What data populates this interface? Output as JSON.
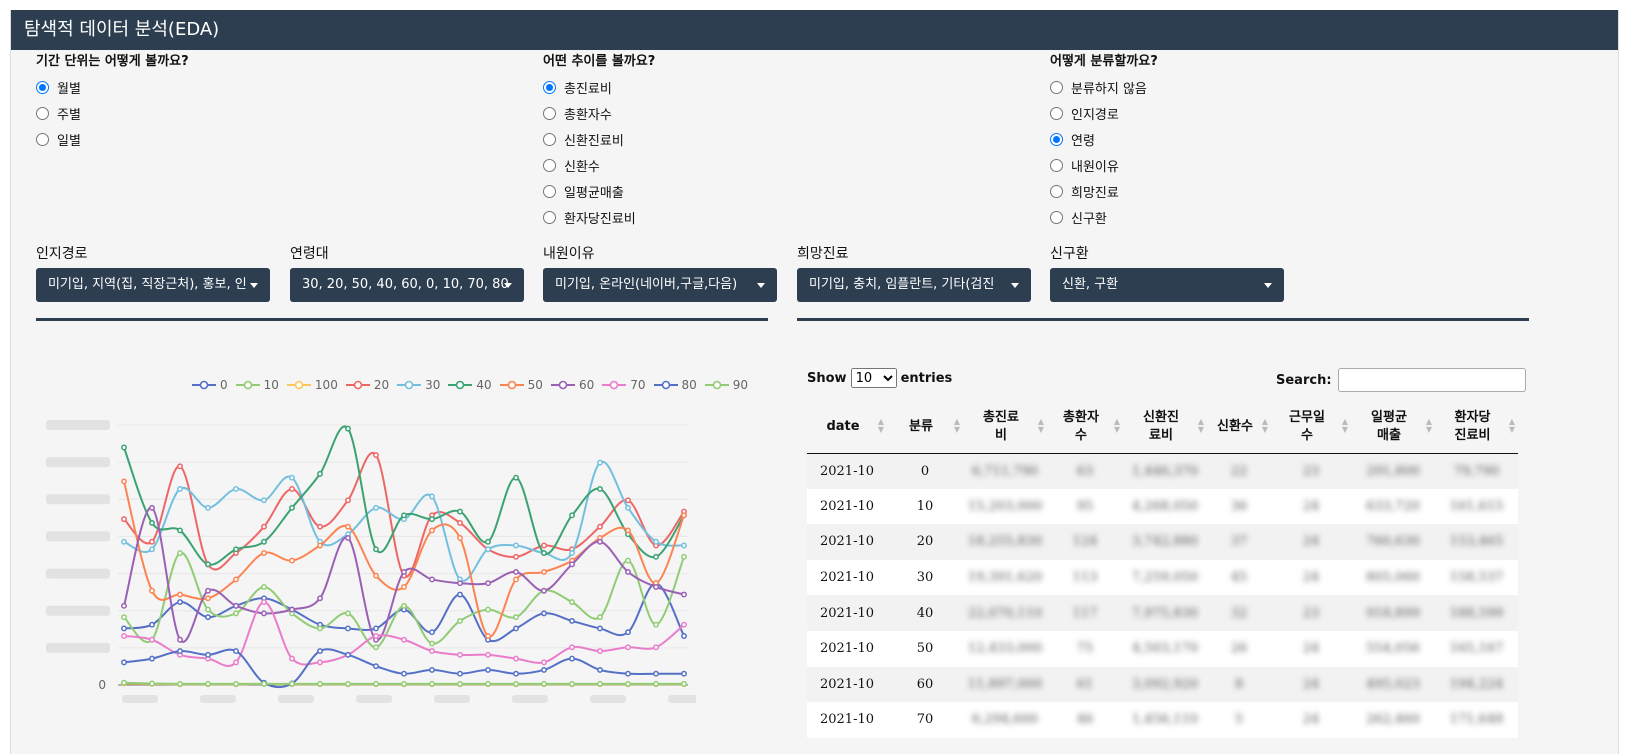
{
  "title": "탐색적 데이터 분석(EDA)",
  "period": {
    "question": "기간 단위는 어떻게 볼까요?",
    "options": [
      "월별",
      "주별",
      "일별"
    ],
    "selected": 0
  },
  "trend": {
    "question": "어떤 추이를 볼까요?",
    "options": [
      "총진료비",
      "총환자수",
      "신환진료비",
      "신환수",
      "일평균매출",
      "환자당진료비"
    ],
    "selected": 0
  },
  "group": {
    "question": "어떻게 분류할까요?",
    "options": [
      "분류하지 않음",
      "인지경로",
      "연령",
      "내원이유",
      "희망진료",
      "신구환"
    ],
    "selected": 2
  },
  "filters": [
    {
      "label": "인지경로",
      "value": "미기입, 지역(집, 직장근처), 홍보, 인"
    },
    {
      "label": "연령대",
      "value": "30, 20, 50, 40, 60, 0, 10, 70, 80"
    },
    {
      "label": "내원이유",
      "value": "미기입, 온라인(네이버,구글,다음)"
    },
    {
      "label": "희망진료",
      "value": "미기입, 충치, 임플란트, 기타(검진"
    },
    {
      "label": "신구환",
      "value": "신환, 구환"
    }
  ],
  "chart_data": {
    "type": "line",
    "y_axis": {
      "min_label": "0"
    },
    "series": [
      {
        "name": "0",
        "color": "#5470c6"
      },
      {
        "name": "10",
        "color": "#91cc75"
      },
      {
        "name": "100",
        "color": "#fac858"
      },
      {
        "name": "20",
        "color": "#ee6666"
      },
      {
        "name": "30",
        "color": "#73c0de"
      },
      {
        "name": "40",
        "color": "#3ba272"
      },
      {
        "name": "50",
        "color": "#fc8452"
      },
      {
        "name": "60",
        "color": "#9a60b4"
      },
      {
        "name": "70",
        "color": "#ea7ccc"
      },
      {
        "name": "80",
        "color": "#5470c6"
      },
      {
        "name": "90",
        "color": "#91cc75"
      }
    ]
  },
  "table": {
    "show_label": "Show",
    "entries_label": "entries",
    "page_size": "10",
    "search_label": "Search:",
    "columns": [
      "date",
      "분류",
      "총진료\n비",
      "총환자\n수",
      "신환진\n료비",
      "신환수",
      "근무일\n수",
      "일평균\n매출",
      "환자당\n진료비"
    ],
    "rows": [
      [
        "2021-10",
        "0",
        "6,711,790",
        "63",
        "1,446,370",
        "22",
        "23",
        "291,800",
        "79,790"
      ],
      [
        "2021-10",
        "10",
        "15,203,000",
        "95",
        "4,268,050",
        "36",
        "24",
        "633,720",
        "161,615"
      ],
      [
        "2021-10",
        "20",
        "18,255,830",
        "124",
        "3,742,880",
        "37",
        "24",
        "760,630",
        "153,465"
      ],
      [
        "2021-10",
        "30",
        "19,391,620",
        "113",
        "7,259,050",
        "45",
        "24",
        "805,060",
        "158,537"
      ],
      [
        "2021-10",
        "40",
        "22,070,110",
        "117",
        "7,975,830",
        "32",
        "23",
        "918,899",
        "188,599"
      ],
      [
        "2021-10",
        "50",
        "12,433,000",
        "75",
        "4,503,170",
        "26",
        "24",
        "554,056",
        "165,167"
      ],
      [
        "2021-10",
        "60",
        "11,897,000",
        "61",
        "3,092,920",
        "8",
        "24",
        "495,023",
        "194,224"
      ],
      [
        "2021-10",
        "70",
        "6,294,600",
        "46",
        "1,456,110",
        "5",
        "24",
        "262,460",
        "171,648"
      ]
    ]
  }
}
